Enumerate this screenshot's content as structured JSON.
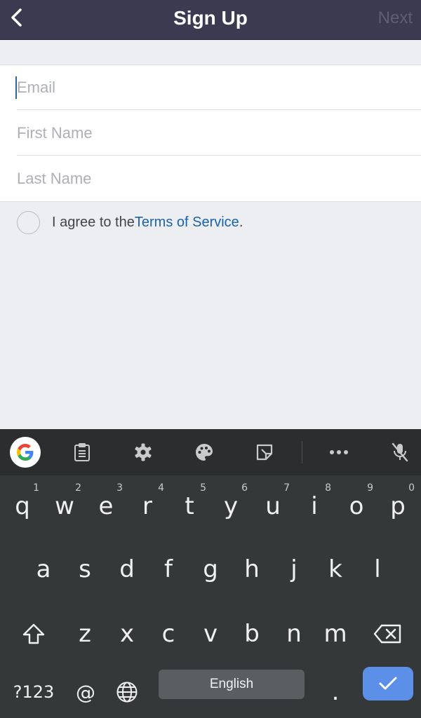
{
  "header": {
    "title": "Sign Up",
    "next_label": "Next"
  },
  "form": {
    "fields": [
      {
        "placeholder": "Email",
        "value": ""
      },
      {
        "placeholder": "First Name",
        "value": ""
      },
      {
        "placeholder": "Last Name",
        "value": ""
      }
    ],
    "focused_field": "Email"
  },
  "agree": {
    "prefix": "I agree to the ",
    "link": "Terms of Service",
    "suffix": ".",
    "checked": false
  },
  "keyboard": {
    "toolbar_icons": [
      "google-icon",
      "clipboard-icon",
      "settings-gear-icon",
      "theme-palette-icon",
      "sticker-icon",
      "more-dots-icon",
      "mic-off-icon"
    ],
    "row1": [
      {
        "key": "q",
        "hint": "1"
      },
      {
        "key": "w",
        "hint": "2"
      },
      {
        "key": "e",
        "hint": "3"
      },
      {
        "key": "r",
        "hint": "4"
      },
      {
        "key": "t",
        "hint": "5"
      },
      {
        "key": "y",
        "hint": "6"
      },
      {
        "key": "u",
        "hint": "7"
      },
      {
        "key": "i",
        "hint": "8"
      },
      {
        "key": "o",
        "hint": "9"
      },
      {
        "key": "p",
        "hint": "0"
      }
    ],
    "row2": [
      "a",
      "s",
      "d",
      "f",
      "g",
      "h",
      "j",
      "k",
      "l"
    ],
    "row3": [
      "z",
      "x",
      "c",
      "v",
      "b",
      "n",
      "m"
    ],
    "symbols_label": "?123",
    "at_label": "@",
    "space_label": "English",
    "period_label": ".",
    "accent_color": "#5b8fe8",
    "background_color": "#353839"
  }
}
